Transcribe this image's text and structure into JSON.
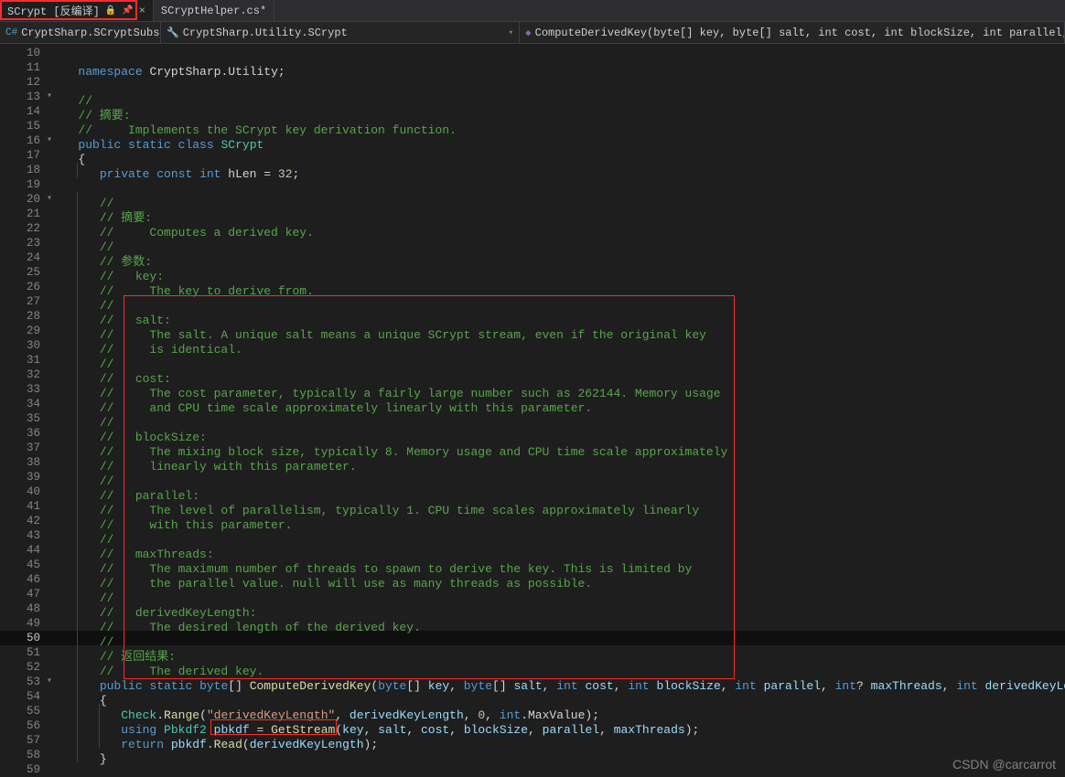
{
  "tabs": [
    {
      "label": "SCrypt [反编译]",
      "active": true,
      "locked": true,
      "pinned": true
    },
    {
      "label": "SCryptHelper.cs*",
      "active": false
    }
  ],
  "context": {
    "left": "CryptSharp.SCryptSubse",
    "mid": "CryptSharp.Utility.SCrypt",
    "right": "ComputeDerivedKey(byte[] key, byte[] salt, int cost, int blockSize, int parallel, int? maxThreads, in"
  },
  "line_start": 10,
  "current_line": 50,
  "folds": {
    "13": "v",
    "16": "v",
    "20": "v",
    "53": "v"
  },
  "code": [
    {
      "i": ""
    },
    {
      "i": "    ",
      "t": [
        [
          "kw",
          "namespace"
        ],
        [
          "pl",
          " "
        ],
        [
          "pl",
          "CryptSharp"
        ],
        [
          "pn",
          "."
        ],
        [
          "pl",
          "Utility"
        ],
        [
          "pn",
          ";"
        ]
      ]
    },
    {
      "i": ""
    },
    {
      "i": "    ",
      "t": [
        [
          "cm",
          "//"
        ]
      ],
      "fold": "v"
    },
    {
      "i": "    ",
      "t": [
        [
          "cm",
          "// 摘要:"
        ]
      ]
    },
    {
      "i": "    ",
      "t": [
        [
          "cm",
          "//     Implements the SCrypt key derivation function."
        ]
      ]
    },
    {
      "i": "    ",
      "t": [
        [
          "kw",
          "public"
        ],
        [
          "pl",
          " "
        ],
        [
          "kw",
          "static"
        ],
        [
          "pl",
          " "
        ],
        [
          "kw",
          "class"
        ],
        [
          "pl",
          " "
        ],
        [
          "ty",
          "SCrypt"
        ]
      ],
      "fold": "v"
    },
    {
      "i": "    ",
      "t": [
        [
          "pn",
          "{"
        ]
      ]
    },
    {
      "i": "        ",
      "t": [
        [
          "kw",
          "private"
        ],
        [
          "pl",
          " "
        ],
        [
          "kw",
          "const"
        ],
        [
          "pl",
          " "
        ],
        [
          "kw",
          "int"
        ],
        [
          "pl",
          " "
        ],
        [
          "pl",
          "hLen "
        ],
        [
          "pn",
          "="
        ],
        [
          "pl",
          " "
        ],
        [
          "nm",
          "32"
        ],
        [
          "pn",
          ";"
        ]
      ]
    },
    {
      "i": ""
    },
    {
      "i": "        ",
      "t": [
        [
          "cm",
          "//"
        ]
      ],
      "fold": "v"
    },
    {
      "i": "        ",
      "t": [
        [
          "cm",
          "// 摘要:"
        ]
      ]
    },
    {
      "i": "        ",
      "t": [
        [
          "cm",
          "//     Computes a derived key."
        ]
      ]
    },
    {
      "i": "        ",
      "t": [
        [
          "cm",
          "//"
        ]
      ]
    },
    {
      "i": "        ",
      "t": [
        [
          "cm",
          "// 参数:"
        ]
      ]
    },
    {
      "i": "        ",
      "t": [
        [
          "cm",
          "//   key:"
        ]
      ]
    },
    {
      "i": "        ",
      "t": [
        [
          "cm",
          "//     The key to derive from."
        ]
      ]
    },
    {
      "i": "        ",
      "t": [
        [
          "cm",
          "//"
        ]
      ]
    },
    {
      "i": "        ",
      "t": [
        [
          "cm",
          "//   salt:"
        ]
      ]
    },
    {
      "i": "        ",
      "t": [
        [
          "cm",
          "//     The salt. A unique salt means a unique SCrypt stream, even if the original key"
        ]
      ]
    },
    {
      "i": "        ",
      "t": [
        [
          "cm",
          "//     is identical."
        ]
      ]
    },
    {
      "i": "        ",
      "t": [
        [
          "cm",
          "//"
        ]
      ]
    },
    {
      "i": "        ",
      "t": [
        [
          "cm",
          "//   cost:"
        ]
      ]
    },
    {
      "i": "        ",
      "t": [
        [
          "cm",
          "//     The cost parameter, typically a fairly large number such as 262144. Memory usage"
        ]
      ]
    },
    {
      "i": "        ",
      "t": [
        [
          "cm",
          "//     and CPU time scale approximately linearly with this parameter."
        ]
      ]
    },
    {
      "i": "        ",
      "t": [
        [
          "cm",
          "//"
        ]
      ]
    },
    {
      "i": "        ",
      "t": [
        [
          "cm",
          "//   blockSize:"
        ]
      ]
    },
    {
      "i": "        ",
      "t": [
        [
          "cm",
          "//     The mixing block size, typically 8. Memory usage and CPU time scale approximately"
        ]
      ]
    },
    {
      "i": "        ",
      "t": [
        [
          "cm",
          "//     linearly with this parameter."
        ]
      ]
    },
    {
      "i": "        ",
      "t": [
        [
          "cm",
          "//"
        ]
      ]
    },
    {
      "i": "        ",
      "t": [
        [
          "cm",
          "//   parallel:"
        ]
      ]
    },
    {
      "i": "        ",
      "t": [
        [
          "cm",
          "//     The level of parallelism, typically 1. CPU time scales approximately linearly"
        ]
      ]
    },
    {
      "i": "        ",
      "t": [
        [
          "cm",
          "//     with this parameter."
        ]
      ]
    },
    {
      "i": "        ",
      "t": [
        [
          "cm",
          "//"
        ]
      ]
    },
    {
      "i": "        ",
      "t": [
        [
          "cm",
          "//   maxThreads:"
        ]
      ]
    },
    {
      "i": "        ",
      "t": [
        [
          "cm",
          "//     The maximum number of threads to spawn to derive the key. This is limited by"
        ]
      ]
    },
    {
      "i": "        ",
      "t": [
        [
          "cm",
          "//     the parallel value. null will use as many threads as possible."
        ]
      ]
    },
    {
      "i": "        ",
      "t": [
        [
          "cm",
          "//"
        ]
      ]
    },
    {
      "i": "        ",
      "t": [
        [
          "cm",
          "//   derivedKeyLength:"
        ]
      ]
    },
    {
      "i": "        ",
      "t": [
        [
          "cm",
          "//     The desired length of the derived key."
        ]
      ]
    },
    {
      "i": "        ",
      "t": [
        [
          "cm",
          "//"
        ]
      ],
      "current": true
    },
    {
      "i": "        ",
      "t": [
        [
          "cm",
          "// 返回结果:"
        ]
      ]
    },
    {
      "i": "        ",
      "t": [
        [
          "cm",
          "//     The derived key."
        ]
      ]
    },
    {
      "i": "        ",
      "t": [
        [
          "kw",
          "public"
        ],
        [
          "pl",
          " "
        ],
        [
          "kw",
          "static"
        ],
        [
          "pl",
          " "
        ],
        [
          "kw",
          "byte"
        ],
        [
          "pn",
          "[]"
        ],
        [
          "pl",
          " "
        ],
        [
          "id",
          "ComputeDerivedKey"
        ],
        [
          "pn",
          "("
        ],
        [
          "kw",
          "byte"
        ],
        [
          "pn",
          "[]"
        ],
        [
          "pl",
          " "
        ],
        [
          "vr",
          "key"
        ],
        [
          "pn",
          ", "
        ],
        [
          "kw",
          "byte"
        ],
        [
          "pn",
          "[]"
        ],
        [
          "pl",
          " "
        ],
        [
          "vr",
          "salt"
        ],
        [
          "pn",
          ", "
        ],
        [
          "kw",
          "int"
        ],
        [
          "pl",
          " "
        ],
        [
          "vr",
          "cost"
        ],
        [
          "pn",
          ", "
        ],
        [
          "kw",
          "int"
        ],
        [
          "pl",
          " "
        ],
        [
          "vr",
          "blockSize"
        ],
        [
          "pn",
          ", "
        ],
        [
          "kw",
          "int"
        ],
        [
          "pl",
          " "
        ],
        [
          "vr",
          "parallel"
        ],
        [
          "pn",
          ", "
        ],
        [
          "kw",
          "int"
        ],
        [
          "pn",
          "?"
        ],
        [
          "pl",
          " "
        ],
        [
          "vr",
          "maxThreads"
        ],
        [
          "pn",
          ", "
        ],
        [
          "kw",
          "int"
        ],
        [
          "pl",
          " "
        ],
        [
          "vr",
          "derivedKeyLength"
        ],
        [
          "pn",
          ")"
        ]
      ],
      "fold": "v"
    },
    {
      "i": "        ",
      "t": [
        [
          "pn",
          "{"
        ]
      ]
    },
    {
      "i": "            ",
      "t": [
        [
          "ty",
          "Check"
        ],
        [
          "pn",
          "."
        ],
        [
          "id",
          "Range"
        ],
        [
          "pn",
          "("
        ],
        [
          "st",
          "\"derivedKeyLength\""
        ],
        [
          "pn",
          ", "
        ],
        [
          "vr",
          "derivedKeyLength"
        ],
        [
          "pn",
          ", "
        ],
        [
          "nm",
          "0"
        ],
        [
          "pn",
          ", "
        ],
        [
          "kw",
          "int"
        ],
        [
          "pn",
          "."
        ],
        [
          "pl",
          "MaxValue"
        ],
        [
          "pn",
          ");"
        ]
      ]
    },
    {
      "i": "            ",
      "t": [
        [
          "kw",
          "using"
        ],
        [
          "pl",
          " "
        ],
        [
          "ty",
          "Pbkdf2"
        ],
        [
          "pl",
          " "
        ],
        [
          "vr",
          "pbkdf"
        ],
        [
          "pl",
          " "
        ],
        [
          "pn",
          "="
        ],
        [
          "pl",
          " "
        ],
        [
          "id",
          "GetStream"
        ],
        [
          "pn",
          "("
        ],
        [
          "vr",
          "key"
        ],
        [
          "pn",
          ", "
        ],
        [
          "vr",
          "salt"
        ],
        [
          "pn",
          ", "
        ],
        [
          "vr",
          "cost"
        ],
        [
          "pn",
          ", "
        ],
        [
          "vr",
          "blockSize"
        ],
        [
          "pn",
          ", "
        ],
        [
          "vr",
          "parallel"
        ],
        [
          "pn",
          ", "
        ],
        [
          "vr",
          "maxThreads"
        ],
        [
          "pn",
          ");"
        ]
      ]
    },
    {
      "i": "            ",
      "t": [
        [
          "kw",
          "return"
        ],
        [
          "pl",
          " "
        ],
        [
          "vr",
          "pbkdf"
        ],
        [
          "pn",
          "."
        ],
        [
          "id",
          "Read"
        ],
        [
          "pn",
          "("
        ],
        [
          "vr",
          "derivedKeyLength"
        ],
        [
          "pn",
          ");"
        ]
      ]
    },
    {
      "i": "        ",
      "t": [
        [
          "pn",
          "}"
        ]
      ]
    },
    {
      "i": ""
    }
  ],
  "watermark": "CSDN @carcarrot"
}
